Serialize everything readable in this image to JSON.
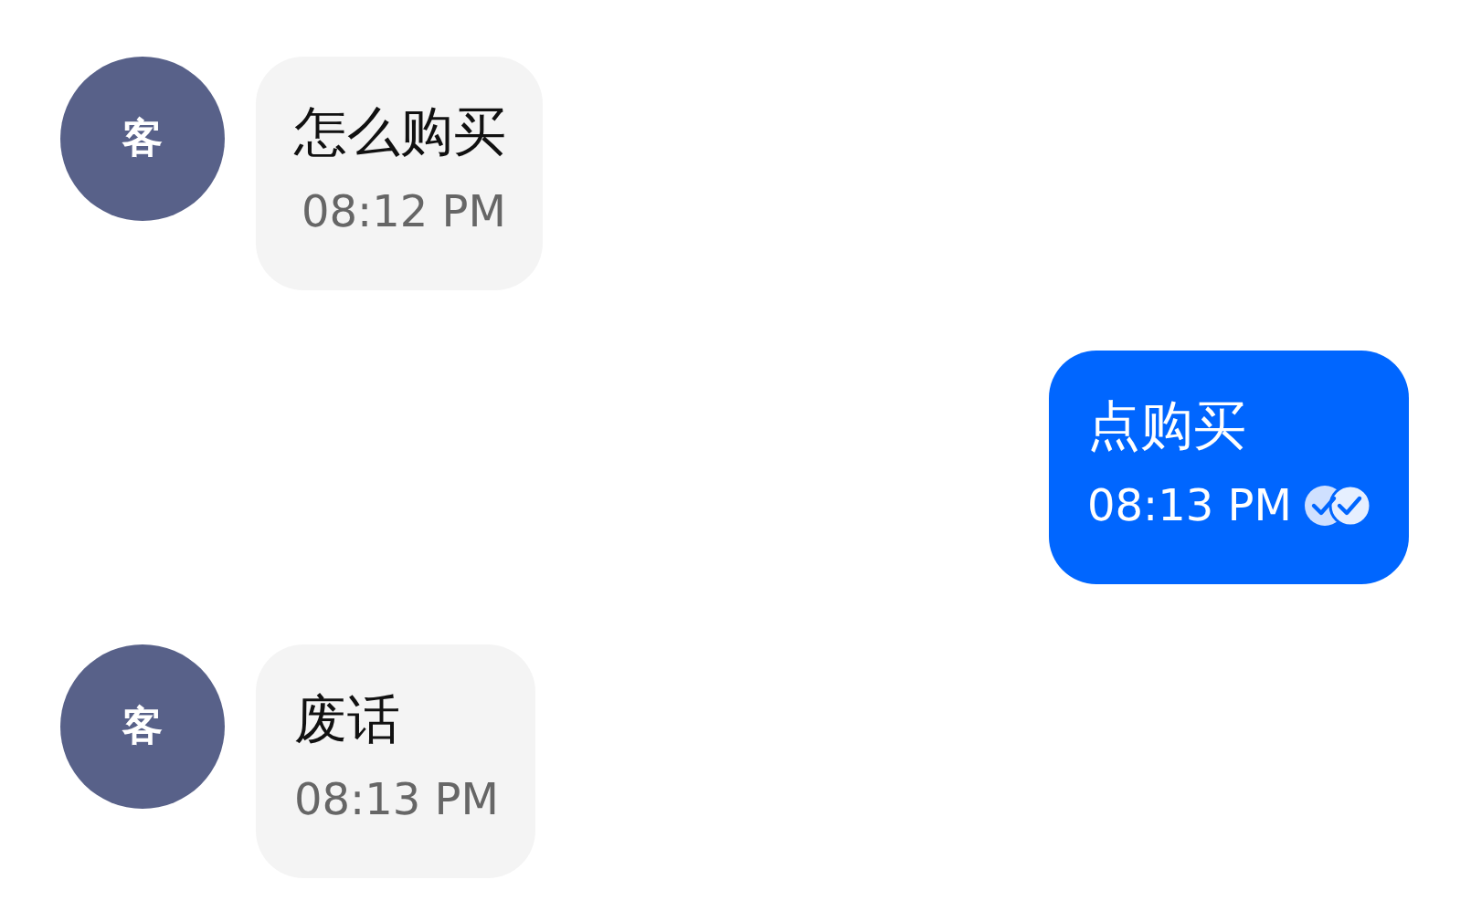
{
  "messages": [
    {
      "kind": "incoming",
      "avatar": "客",
      "text": "怎么购买",
      "time": "08:12 PM"
    },
    {
      "kind": "outgoing",
      "text": "点购买",
      "time": "08:13 PM",
      "read": true
    },
    {
      "kind": "incoming",
      "avatar": "客",
      "text": "废话",
      "time": "08:13 PM"
    }
  ]
}
